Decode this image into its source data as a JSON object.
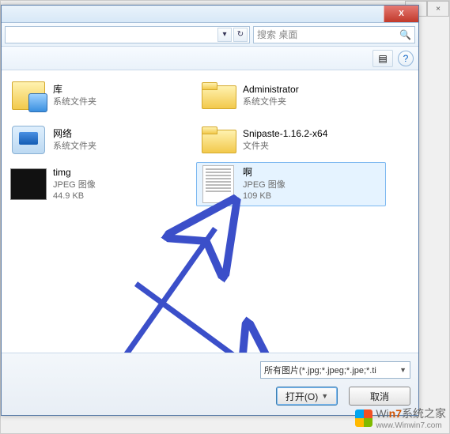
{
  "outer_window": {
    "minimize": "–",
    "close": "×"
  },
  "dialog": {
    "titlebar": {
      "close_label": "X"
    },
    "nav": {
      "refresh_glyph": "↻",
      "dropdown_glyph": "▾"
    },
    "search": {
      "placeholder": "搜索 桌面",
      "icon_glyph": "🔍"
    },
    "toolbar": {
      "view_glyph": "▤",
      "help_glyph": "?"
    }
  },
  "items": [
    {
      "name": "库",
      "sub1": "系统文件夹",
      "sub2": "",
      "icon": "lib"
    },
    {
      "name": "Administrator",
      "sub1": "系统文件夹",
      "sub2": "",
      "icon": "folder"
    },
    {
      "name": "网络",
      "sub1": "系统文件夹",
      "sub2": "",
      "icon": "net"
    },
    {
      "name": "Snipaste-1.16.2-x64",
      "sub1": "文件夹",
      "sub2": "",
      "icon": "folder"
    },
    {
      "name": "timg",
      "sub1": "JPEG 图像",
      "sub2": "44.9 KB",
      "icon": "img"
    },
    {
      "name": "啊",
      "sub1": "JPEG 图像",
      "sub2": "109 KB",
      "icon": "doc",
      "selected": true
    }
  ],
  "bottom": {
    "filter_text": "所有图片(*.jpg;*.jpeg;*.jpe;*.ti",
    "open_label": "打开(O)",
    "cancel_label": "取消"
  },
  "watermark": {
    "brand_html_prefix": "Wi",
    "brand_html_accent": "n7",
    "brand_html_suffix": "系统之家",
    "url": "www.Winwin7.com"
  }
}
